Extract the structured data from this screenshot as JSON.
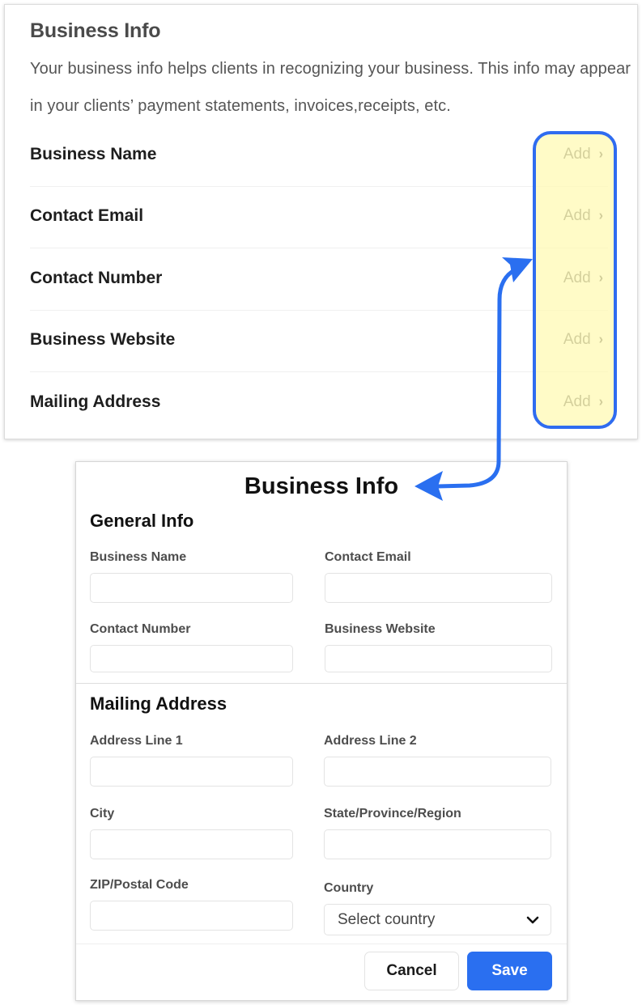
{
  "settings": {
    "title": "Business Info",
    "description": "Your business info helps clients in recognizing your business. This info may appear in your clients’ payment statements, invoices,receipts, etc.",
    "rows": [
      {
        "label": "Business Name",
        "action": "Add",
        "chevron": "›"
      },
      {
        "label": "Contact Email",
        "action": "Add",
        "chevron": "›"
      },
      {
        "label": "Contact Number",
        "action": "Add",
        "chevron": "›"
      },
      {
        "label": "Business Website",
        "action": "Add",
        "chevron": "›"
      },
      {
        "label": "Mailing Address",
        "action": "Add",
        "chevron": "›"
      }
    ]
  },
  "annotation": {
    "highlight_color": "#2f6cf0",
    "highlight_fill": "#fff9b4",
    "arrow_icon": "double-headed-arrow"
  },
  "modal": {
    "title": "Business Info",
    "general_section": "General Info",
    "mailing_section": "Mailing Address",
    "fields": {
      "business_name": {
        "label": "Business Name",
        "value": ""
      },
      "contact_email": {
        "label": "Contact Email",
        "value": ""
      },
      "contact_number": {
        "label": "Contact Number",
        "value": ""
      },
      "business_website": {
        "label": "Business Website",
        "value": ""
      },
      "address_line_1": {
        "label": "Address Line 1",
        "value": ""
      },
      "address_line_2": {
        "label": "Address Line 2",
        "value": ""
      },
      "city": {
        "label": "City",
        "value": ""
      },
      "state": {
        "label": "State/Province/Region",
        "value": ""
      },
      "zip": {
        "label": "ZIP/Postal Code",
        "value": ""
      },
      "country": {
        "label": "Country",
        "placeholder": "Select country",
        "icon": "chevron-down-icon"
      }
    },
    "buttons": {
      "cancel": "Cancel",
      "save": "Save"
    },
    "accent_color": "#2a6ff0"
  }
}
